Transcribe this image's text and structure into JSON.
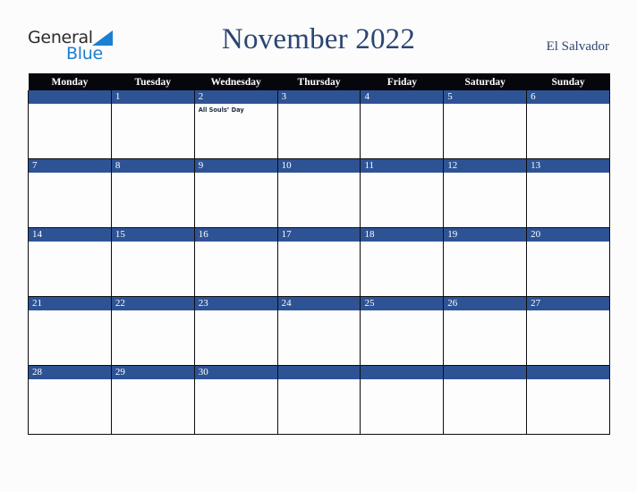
{
  "brand": {
    "name_part1": "General",
    "name_part2": "Blue",
    "triangle_icon": "blue-triangle-icon",
    "accent_color": "#1c7fd0",
    "text_color": "#2b2b2b"
  },
  "header": {
    "month_title": "November 2022",
    "country": "El Salvador",
    "title_color": "#2b4571"
  },
  "calendar": {
    "header_bg": "#06060d",
    "daybar_bg": "#2e5395",
    "cell_bg": "#fdfdfd",
    "grid_line_color": "#0c0c12",
    "weekday_headers": [
      "Monday",
      "Tuesday",
      "Wednesday",
      "Thursday",
      "Friday",
      "Saturday",
      "Sunday"
    ],
    "weeks": [
      [
        {
          "date": "",
          "events": []
        },
        {
          "date": "1",
          "events": []
        },
        {
          "date": "2",
          "events": [
            "All Souls’ Day"
          ]
        },
        {
          "date": "3",
          "events": []
        },
        {
          "date": "4",
          "events": []
        },
        {
          "date": "5",
          "events": []
        },
        {
          "date": "6",
          "events": []
        }
      ],
      [
        {
          "date": "7",
          "events": []
        },
        {
          "date": "8",
          "events": []
        },
        {
          "date": "9",
          "events": []
        },
        {
          "date": "10",
          "events": []
        },
        {
          "date": "11",
          "events": []
        },
        {
          "date": "12",
          "events": []
        },
        {
          "date": "13",
          "events": []
        }
      ],
      [
        {
          "date": "14",
          "events": []
        },
        {
          "date": "15",
          "events": []
        },
        {
          "date": "16",
          "events": []
        },
        {
          "date": "17",
          "events": []
        },
        {
          "date": "18",
          "events": []
        },
        {
          "date": "19",
          "events": []
        },
        {
          "date": "20",
          "events": []
        }
      ],
      [
        {
          "date": "21",
          "events": []
        },
        {
          "date": "22",
          "events": []
        },
        {
          "date": "23",
          "events": []
        },
        {
          "date": "24",
          "events": []
        },
        {
          "date": "25",
          "events": []
        },
        {
          "date": "26",
          "events": []
        },
        {
          "date": "27",
          "events": []
        }
      ],
      [
        {
          "date": "28",
          "events": []
        },
        {
          "date": "29",
          "events": []
        },
        {
          "date": "30",
          "events": []
        },
        {
          "date": "",
          "events": []
        },
        {
          "date": "",
          "events": []
        },
        {
          "date": "",
          "events": []
        },
        {
          "date": "",
          "events": []
        }
      ]
    ]
  }
}
